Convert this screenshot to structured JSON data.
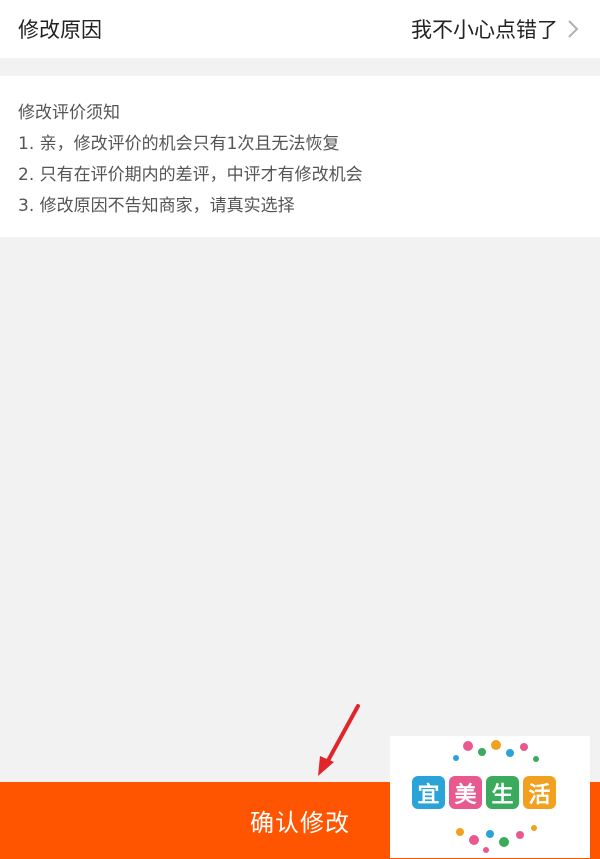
{
  "reason": {
    "label": "修改原因",
    "value": "我不小心点错了"
  },
  "notice": {
    "title": "修改评价须知",
    "items": [
      "1. 亲，修改评价的机会只有1次且无法恢复",
      "2. 只有在评价期内的差评，中评才有修改机会",
      "3. 修改原因不告知商家，请真实选择"
    ]
  },
  "actions": {
    "confirm_label": "确认修改"
  },
  "watermark": {
    "chars": [
      "宜",
      "美",
      "生",
      "活"
    ],
    "colors": [
      "#2aa4d8",
      "#e8598f",
      "#3aaa5c",
      "#f2a020"
    ]
  },
  "colors": {
    "accent": "#ff5500",
    "arrow": "#e0262b"
  }
}
